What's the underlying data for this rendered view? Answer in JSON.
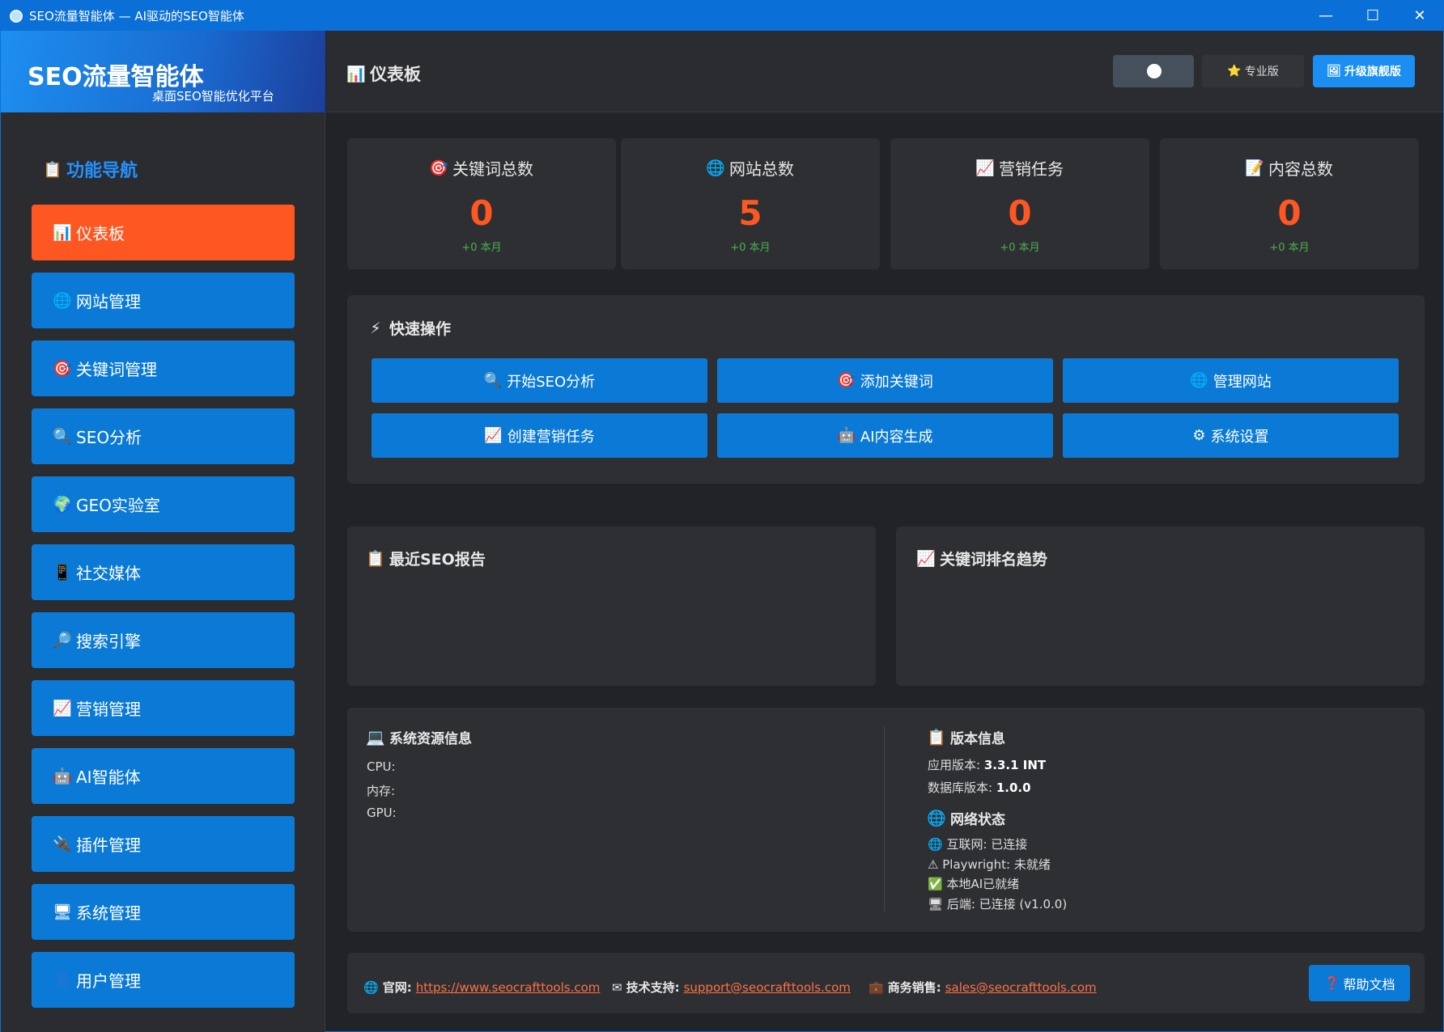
{
  "window": {
    "title": "SEO流量智能体 — AI驱动的SEO智能体",
    "minimize": "—",
    "maximize": "☐",
    "close": "✕"
  },
  "brand": {
    "name": "SEO流量智能体",
    "subtitle": "桌面SEO智能优化平台"
  },
  "nav": {
    "title": "功能导航",
    "items": [
      {
        "label": "仪表板",
        "icon": "chart-icon"
      },
      {
        "label": "网站管理",
        "icon": "globe-icon"
      },
      {
        "label": "关键词管理",
        "icon": "target-icon"
      },
      {
        "label": "SEO分析",
        "icon": "search-icon"
      },
      {
        "label": "GEO实验室",
        "icon": "earth-icon"
      },
      {
        "label": "社交媒体",
        "icon": "phone-icon"
      },
      {
        "label": "搜索引擎",
        "icon": "magnifier-icon"
      },
      {
        "label": "营销管理",
        "icon": "trend-icon"
      },
      {
        "label": "AI智能体",
        "icon": "robot-icon"
      },
      {
        "label": "插件管理",
        "icon": "plug-icon"
      },
      {
        "label": "系统管理",
        "icon": "monitor-icon"
      },
      {
        "label": "用户管理",
        "icon": "user-icon"
      }
    ]
  },
  "header": {
    "title": "仪表板",
    "pro": "专业版",
    "upgrade": "升级旗舰版"
  },
  "stats": [
    {
      "label": "关键词总数",
      "value": "0",
      "delta": "+0 本月"
    },
    {
      "label": "网站总数",
      "value": "5",
      "delta": "+0 本月"
    },
    {
      "label": "营销任务",
      "value": "0",
      "delta": "+0 本月"
    },
    {
      "label": "内容总数",
      "value": "0",
      "delta": "+0 本月"
    }
  ],
  "quick": {
    "title": "快速操作",
    "buttons": [
      "开始SEO分析",
      "添加关键词",
      "管理网站",
      "创建营销任务",
      "AI内容生成",
      "系统设置"
    ]
  },
  "reports": {
    "title": "最近SEO报告"
  },
  "trend": {
    "title": "关键词排名趋势"
  },
  "system": {
    "title": "系统资源信息",
    "cpu": "CPU:",
    "mem": "内存:",
    "gpu": "GPU:"
  },
  "version": {
    "title": "版本信息",
    "app_label": "应用版本:",
    "app_value": "3.3.1 INT",
    "db_label": "数据库版本:",
    "db_value": "1.0.0"
  },
  "network": {
    "title": "网络状态",
    "internet": "互联网: 已连接",
    "playwright": "Playwright: 未就绪",
    "ai": "本地AI已就绪",
    "backend": "后端: 已连接 (v1.0.0)"
  },
  "footer": {
    "site_label": "官网:",
    "site_url": "https://www.seocrafttools.com",
    "support_label": "技术支持:",
    "support_email": "support@seocrafttools.com",
    "sales_label": "商务销售:",
    "sales_email": "sales@seocrafttools.com",
    "help": "帮助文档"
  }
}
